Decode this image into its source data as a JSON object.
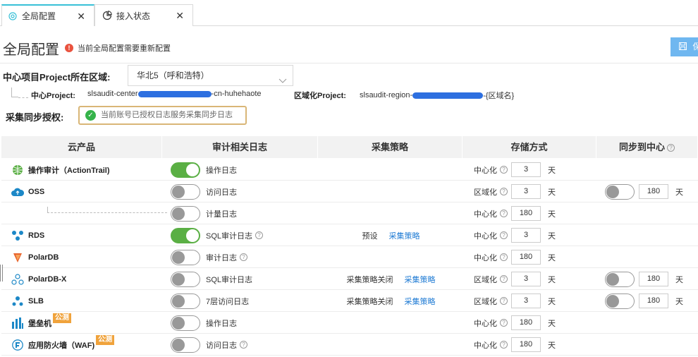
{
  "tabs": [
    {
      "label": "全局配置",
      "icon": "target-icon",
      "active": true
    },
    {
      "label": "接入状态",
      "icon": "pie-chart-icon",
      "active": false
    }
  ],
  "close_glyph": "✕",
  "page_title": "全局配置",
  "warning_text": "当前全局配置需要重新配置",
  "save_label": "保",
  "region": {
    "label": "中心项目Project所在区域:",
    "selected": "华北5（呼和浩特）"
  },
  "center_project": {
    "label": "中心Project:",
    "prefix": "slsaudit-center",
    "suffix": "-cn-huhehaote"
  },
  "region_project": {
    "label": "区域化Project:",
    "prefix": "slsaudit-region-",
    "suffix": "-{区域名}"
  },
  "auth": {
    "label": "采集同步授权:",
    "status_text": "当前账号已授权日志服务采集同步日志"
  },
  "table": {
    "headers": [
      "云产品",
      "审计相关日志",
      "采集策略",
      "存储方式",
      "同步到中心"
    ],
    "day_unit": "天",
    "beta_label": "公测",
    "rows": [
      {
        "product": "操作审计（ActionTrail)",
        "icon": "globe-icon",
        "icon_color": "#5aaf44",
        "toggle_on": true,
        "log": "操作日志",
        "log_help": false,
        "strategy": "",
        "strategy_link": "",
        "storage": "中心化",
        "days": "3",
        "sync_on": null,
        "sync_days": ""
      },
      {
        "product": "OSS",
        "icon": "cloud-icon",
        "icon_color": "#1c88c7",
        "toggle_on": false,
        "log": "访问日志",
        "log_help": false,
        "strategy": "",
        "strategy_link": "",
        "storage": "区域化",
        "days": "3",
        "sync_on": false,
        "sync_days": "180"
      },
      {
        "product": "",
        "icon": "",
        "icon_color": "",
        "toggle_on": false,
        "log": "计量日志",
        "log_help": false,
        "strategy": "",
        "strategy_link": "",
        "storage": "中心化",
        "days": "180",
        "sync_on": null,
        "sync_days": ""
      },
      {
        "product": "RDS",
        "icon": "database-icon",
        "icon_color": "#1c88c7",
        "toggle_on": true,
        "log": "SQL审计日志",
        "log_help": true,
        "strategy": "预设",
        "strategy_link": "采集策略",
        "storage": "中心化",
        "days": "3",
        "sync_on": null,
        "sync_days": ""
      },
      {
        "product": "PolarDB",
        "icon": "polardb-icon",
        "icon_color": "#e8632c",
        "toggle_on": false,
        "log": "审计日志",
        "log_help": true,
        "strategy": "",
        "strategy_link": "",
        "storage": "中心化",
        "days": "180",
        "sync_on": null,
        "sync_days": ""
      },
      {
        "product": "PolarDB-X",
        "icon": "nodes-icon",
        "icon_color": "#1c88c7",
        "toggle_on": false,
        "log": "SQL审计日志",
        "log_help": false,
        "strategy": "采集策略关闭",
        "strategy_link": "采集策略",
        "storage": "区域化",
        "days": "3",
        "sync_on": false,
        "sync_days": "180"
      },
      {
        "product": "SLB",
        "icon": "balancer-icon",
        "icon_color": "#1c88c7",
        "toggle_on": false,
        "log": "7层访问日志",
        "log_help": false,
        "strategy": "采集策略关闭",
        "strategy_link": "采集策略",
        "storage": "区域化",
        "days": "3",
        "sync_on": false,
        "sync_days": "180"
      },
      {
        "product": "堡垒机",
        "icon": "bar-chart-icon",
        "icon_color": "#1c88c7",
        "beta": true,
        "toggle_on": false,
        "log": "操作日志",
        "log_help": false,
        "strategy": "",
        "strategy_link": "",
        "storage": "中心化",
        "days": "180",
        "sync_on": null,
        "sync_days": ""
      },
      {
        "product": "应用防火墙（WAF)",
        "icon": "shield-icon",
        "icon_color": "#1c88c7",
        "beta": true,
        "toggle_on": false,
        "log": "访问日志",
        "log_help": true,
        "strategy": "",
        "strategy_link": "",
        "storage": "中心化",
        "days": "180",
        "sync_on": null,
        "sync_days": ""
      }
    ]
  }
}
